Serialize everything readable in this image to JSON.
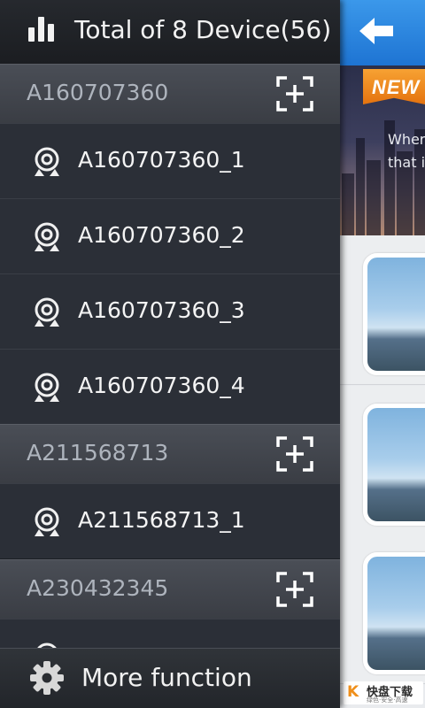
{
  "header": {
    "title": "Total of 8 Device(56)",
    "icon": "bar-chart-icon"
  },
  "groups": [
    {
      "name": "A160707360",
      "devices": [
        "A160707360_1",
        "A160707360_2",
        "A160707360_3",
        "A160707360_4"
      ]
    },
    {
      "name": "A211568713",
      "devices": [
        "A211568713_1"
      ]
    },
    {
      "name": "A230432345",
      "devices": [
        ""
      ]
    }
  ],
  "footer": {
    "label": "More function",
    "icon": "gear-icon"
  },
  "right_panel": {
    "badge": "NEW",
    "banner_lines": [
      "Wher",
      "that is"
    ],
    "back_icon": "back-arrow-icon"
  },
  "watermark": {
    "logo": "K",
    "text": "快盘下载",
    "sub": "绿色·安全·高速"
  },
  "colors": {
    "accent_blue": "#2a86e0",
    "drawer_bg": "#2b2f36",
    "badge_orange": "#ee8a1e"
  }
}
